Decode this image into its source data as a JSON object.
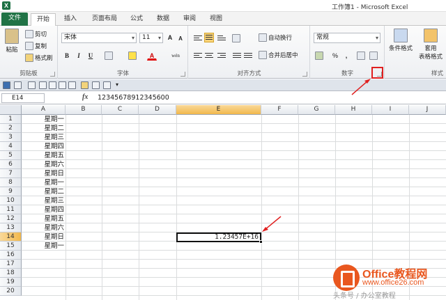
{
  "window": {
    "title": "工作簿1 - Microsoft Excel",
    "logo_letter": "X"
  },
  "tabs": [
    {
      "label": "文件"
    },
    {
      "label": "开始"
    },
    {
      "label": "插入"
    },
    {
      "label": "页面布局"
    },
    {
      "label": "公式"
    },
    {
      "label": "数据"
    },
    {
      "label": "审阅"
    },
    {
      "label": "视图"
    }
  ],
  "ribbon": {
    "clipboard": {
      "label": "剪贴板",
      "paste": "粘贴",
      "cut": "剪切",
      "copy": "复制",
      "format_painter": "格式刷"
    },
    "font": {
      "label": "字体",
      "font_name": "宋体",
      "font_size": "11",
      "bold": "B",
      "italic": "I",
      "underline": "U",
      "grow": "A",
      "shrink": "A",
      "phonetic": "wén"
    },
    "alignment": {
      "label": "对齐方式",
      "wrap": "自动换行",
      "merge": "合并后居中"
    },
    "number": {
      "label": "数字",
      "format": "常规",
      "percent": "%",
      "comma": ","
    },
    "styles": {
      "label": "样式",
      "conditional": "条件格式",
      "table": "套用",
      "table2": "表格格式"
    }
  },
  "formula_bar": {
    "name_box": "E14",
    "fx": "fx",
    "content": "12345678912345600"
  },
  "columns": [
    "A",
    "B",
    "C",
    "D",
    "E",
    "F",
    "G",
    "H",
    "I",
    "J"
  ],
  "rows": [
    "1",
    "2",
    "3",
    "4",
    "5",
    "6",
    "7",
    "8",
    "9",
    "10",
    "11",
    "12",
    "13",
    "14",
    "15",
    "16",
    "17",
    "18",
    "19",
    "20"
  ],
  "column_a": [
    "星期一",
    "星期二",
    "星期三",
    "星期四",
    "星期五",
    "星期六",
    "星期日",
    "星期一",
    "星期二",
    "星期三",
    "星期四",
    "星期五",
    "星期六",
    "星期日",
    "星期一"
  ],
  "selected_cell": {
    "ref": "E14",
    "display": "1.23457E+16"
  },
  "watermark": {
    "brand": "Office教程网",
    "url": "www.office26.com",
    "credit": "头条号 / 办公室教程"
  }
}
